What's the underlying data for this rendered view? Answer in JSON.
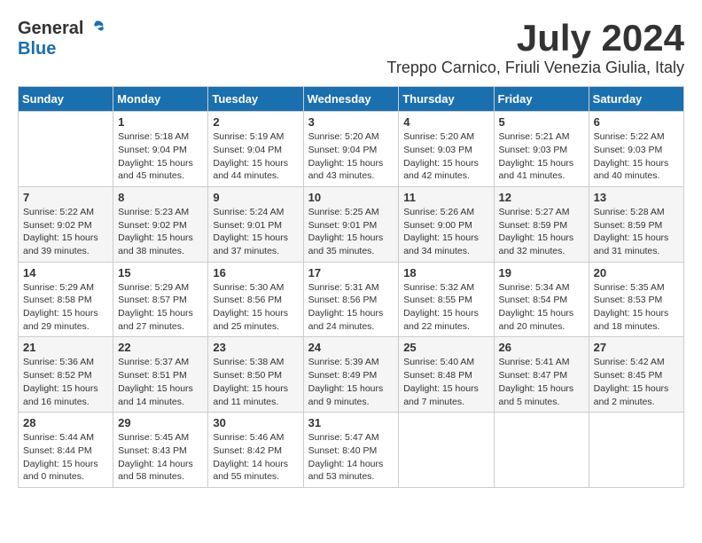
{
  "header": {
    "logo_general": "General",
    "logo_blue": "Blue",
    "month_year": "July 2024",
    "location": "Treppo Carnico, Friuli Venezia Giulia, Italy"
  },
  "weekdays": [
    "Sunday",
    "Monday",
    "Tuesday",
    "Wednesday",
    "Thursday",
    "Friday",
    "Saturday"
  ],
  "weeks": [
    [
      {
        "day": "",
        "info": ""
      },
      {
        "day": "1",
        "info": "Sunrise: 5:18 AM\nSunset: 9:04 PM\nDaylight: 15 hours\nand 45 minutes."
      },
      {
        "day": "2",
        "info": "Sunrise: 5:19 AM\nSunset: 9:04 PM\nDaylight: 15 hours\nand 44 minutes."
      },
      {
        "day": "3",
        "info": "Sunrise: 5:20 AM\nSunset: 9:04 PM\nDaylight: 15 hours\nand 43 minutes."
      },
      {
        "day": "4",
        "info": "Sunrise: 5:20 AM\nSunset: 9:03 PM\nDaylight: 15 hours\nand 42 minutes."
      },
      {
        "day": "5",
        "info": "Sunrise: 5:21 AM\nSunset: 9:03 PM\nDaylight: 15 hours\nand 41 minutes."
      },
      {
        "day": "6",
        "info": "Sunrise: 5:22 AM\nSunset: 9:03 PM\nDaylight: 15 hours\nand 40 minutes."
      }
    ],
    [
      {
        "day": "7",
        "info": "Sunrise: 5:22 AM\nSunset: 9:02 PM\nDaylight: 15 hours\nand 39 minutes."
      },
      {
        "day": "8",
        "info": "Sunrise: 5:23 AM\nSunset: 9:02 PM\nDaylight: 15 hours\nand 38 minutes."
      },
      {
        "day": "9",
        "info": "Sunrise: 5:24 AM\nSunset: 9:01 PM\nDaylight: 15 hours\nand 37 minutes."
      },
      {
        "day": "10",
        "info": "Sunrise: 5:25 AM\nSunset: 9:01 PM\nDaylight: 15 hours\nand 35 minutes."
      },
      {
        "day": "11",
        "info": "Sunrise: 5:26 AM\nSunset: 9:00 PM\nDaylight: 15 hours\nand 34 minutes."
      },
      {
        "day": "12",
        "info": "Sunrise: 5:27 AM\nSunset: 8:59 PM\nDaylight: 15 hours\nand 32 minutes."
      },
      {
        "day": "13",
        "info": "Sunrise: 5:28 AM\nSunset: 8:59 PM\nDaylight: 15 hours\nand 31 minutes."
      }
    ],
    [
      {
        "day": "14",
        "info": "Sunrise: 5:29 AM\nSunset: 8:58 PM\nDaylight: 15 hours\nand 29 minutes."
      },
      {
        "day": "15",
        "info": "Sunrise: 5:29 AM\nSunset: 8:57 PM\nDaylight: 15 hours\nand 27 minutes."
      },
      {
        "day": "16",
        "info": "Sunrise: 5:30 AM\nSunset: 8:56 PM\nDaylight: 15 hours\nand 25 minutes."
      },
      {
        "day": "17",
        "info": "Sunrise: 5:31 AM\nSunset: 8:56 PM\nDaylight: 15 hours\nand 24 minutes."
      },
      {
        "day": "18",
        "info": "Sunrise: 5:32 AM\nSunset: 8:55 PM\nDaylight: 15 hours\nand 22 minutes."
      },
      {
        "day": "19",
        "info": "Sunrise: 5:34 AM\nSunset: 8:54 PM\nDaylight: 15 hours\nand 20 minutes."
      },
      {
        "day": "20",
        "info": "Sunrise: 5:35 AM\nSunset: 8:53 PM\nDaylight: 15 hours\nand 18 minutes."
      }
    ],
    [
      {
        "day": "21",
        "info": "Sunrise: 5:36 AM\nSunset: 8:52 PM\nDaylight: 15 hours\nand 16 minutes."
      },
      {
        "day": "22",
        "info": "Sunrise: 5:37 AM\nSunset: 8:51 PM\nDaylight: 15 hours\nand 14 minutes."
      },
      {
        "day": "23",
        "info": "Sunrise: 5:38 AM\nSunset: 8:50 PM\nDaylight: 15 hours\nand 11 minutes."
      },
      {
        "day": "24",
        "info": "Sunrise: 5:39 AM\nSunset: 8:49 PM\nDaylight: 15 hours\nand 9 minutes."
      },
      {
        "day": "25",
        "info": "Sunrise: 5:40 AM\nSunset: 8:48 PM\nDaylight: 15 hours\nand 7 minutes."
      },
      {
        "day": "26",
        "info": "Sunrise: 5:41 AM\nSunset: 8:47 PM\nDaylight: 15 hours\nand 5 minutes."
      },
      {
        "day": "27",
        "info": "Sunrise: 5:42 AM\nSunset: 8:45 PM\nDaylight: 15 hours\nand 2 minutes."
      }
    ],
    [
      {
        "day": "28",
        "info": "Sunrise: 5:44 AM\nSunset: 8:44 PM\nDaylight: 15 hours\nand 0 minutes."
      },
      {
        "day": "29",
        "info": "Sunrise: 5:45 AM\nSunset: 8:43 PM\nDaylight: 14 hours\nand 58 minutes."
      },
      {
        "day": "30",
        "info": "Sunrise: 5:46 AM\nSunset: 8:42 PM\nDaylight: 14 hours\nand 55 minutes."
      },
      {
        "day": "31",
        "info": "Sunrise: 5:47 AM\nSunset: 8:40 PM\nDaylight: 14 hours\nand 53 minutes."
      },
      {
        "day": "",
        "info": ""
      },
      {
        "day": "",
        "info": ""
      },
      {
        "day": "",
        "info": ""
      }
    ]
  ]
}
